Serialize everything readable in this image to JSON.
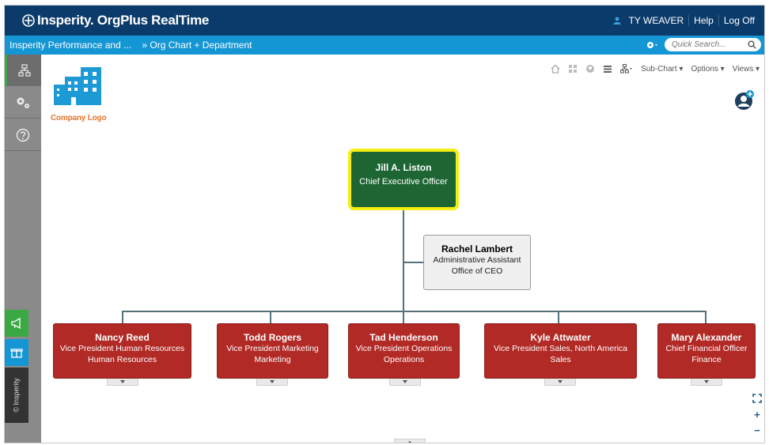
{
  "app": {
    "brand": "Insperity. OrgPlus RealTime",
    "user_name": "TY WEAVER",
    "help_label": "Help",
    "logoff_label": "Log Off"
  },
  "breadcrumb": {
    "item1": "Insperity Performance and ...",
    "item2": "» Org Chart + Department"
  },
  "search": {
    "placeholder": "Quick Search..."
  },
  "company_logo": {
    "label": "Company Logo"
  },
  "toolbar": {
    "subchart_label": "Sub-Chart ▾",
    "options_label": "Options ▾",
    "views_label": "Views ▾"
  },
  "sidebar": {
    "brand_label": "© Insperity"
  },
  "org": {
    "ceo": {
      "name": "Jill A. Liston",
      "title": "Chief Executive Officer"
    },
    "assistant": {
      "name": "Rachel Lambert",
      "title": "Administrative Assistant",
      "dept": "Office of CEO"
    },
    "vps": [
      {
        "name": "Nancy Reed",
        "title": "Vice President Human Resources",
        "dept": "Human Resources"
      },
      {
        "name": "Todd Rogers",
        "title": "Vice President Marketing",
        "dept": "Marketing"
      },
      {
        "name": "Tad Henderson",
        "title": "Vice President Operations",
        "dept": "Operations"
      },
      {
        "name": "Kyle Attwater",
        "title": "Vice President Sales, North America",
        "dept": "Sales"
      },
      {
        "name": "Mary Alexander",
        "title": "Chief Financial Officer",
        "dept": "Finance"
      }
    ]
  },
  "colors": {
    "topbar": "#0b3b6a",
    "crumbbar": "#1496d4",
    "ceo_fill": "#1d6634",
    "ceo_highlight": "#f4ee12",
    "vp_fill": "#b12a26",
    "connector": "#55717a",
    "logo_orange": "#e8742a"
  },
  "zoom": {
    "zoom_in": "+",
    "zoom_out": "−"
  }
}
